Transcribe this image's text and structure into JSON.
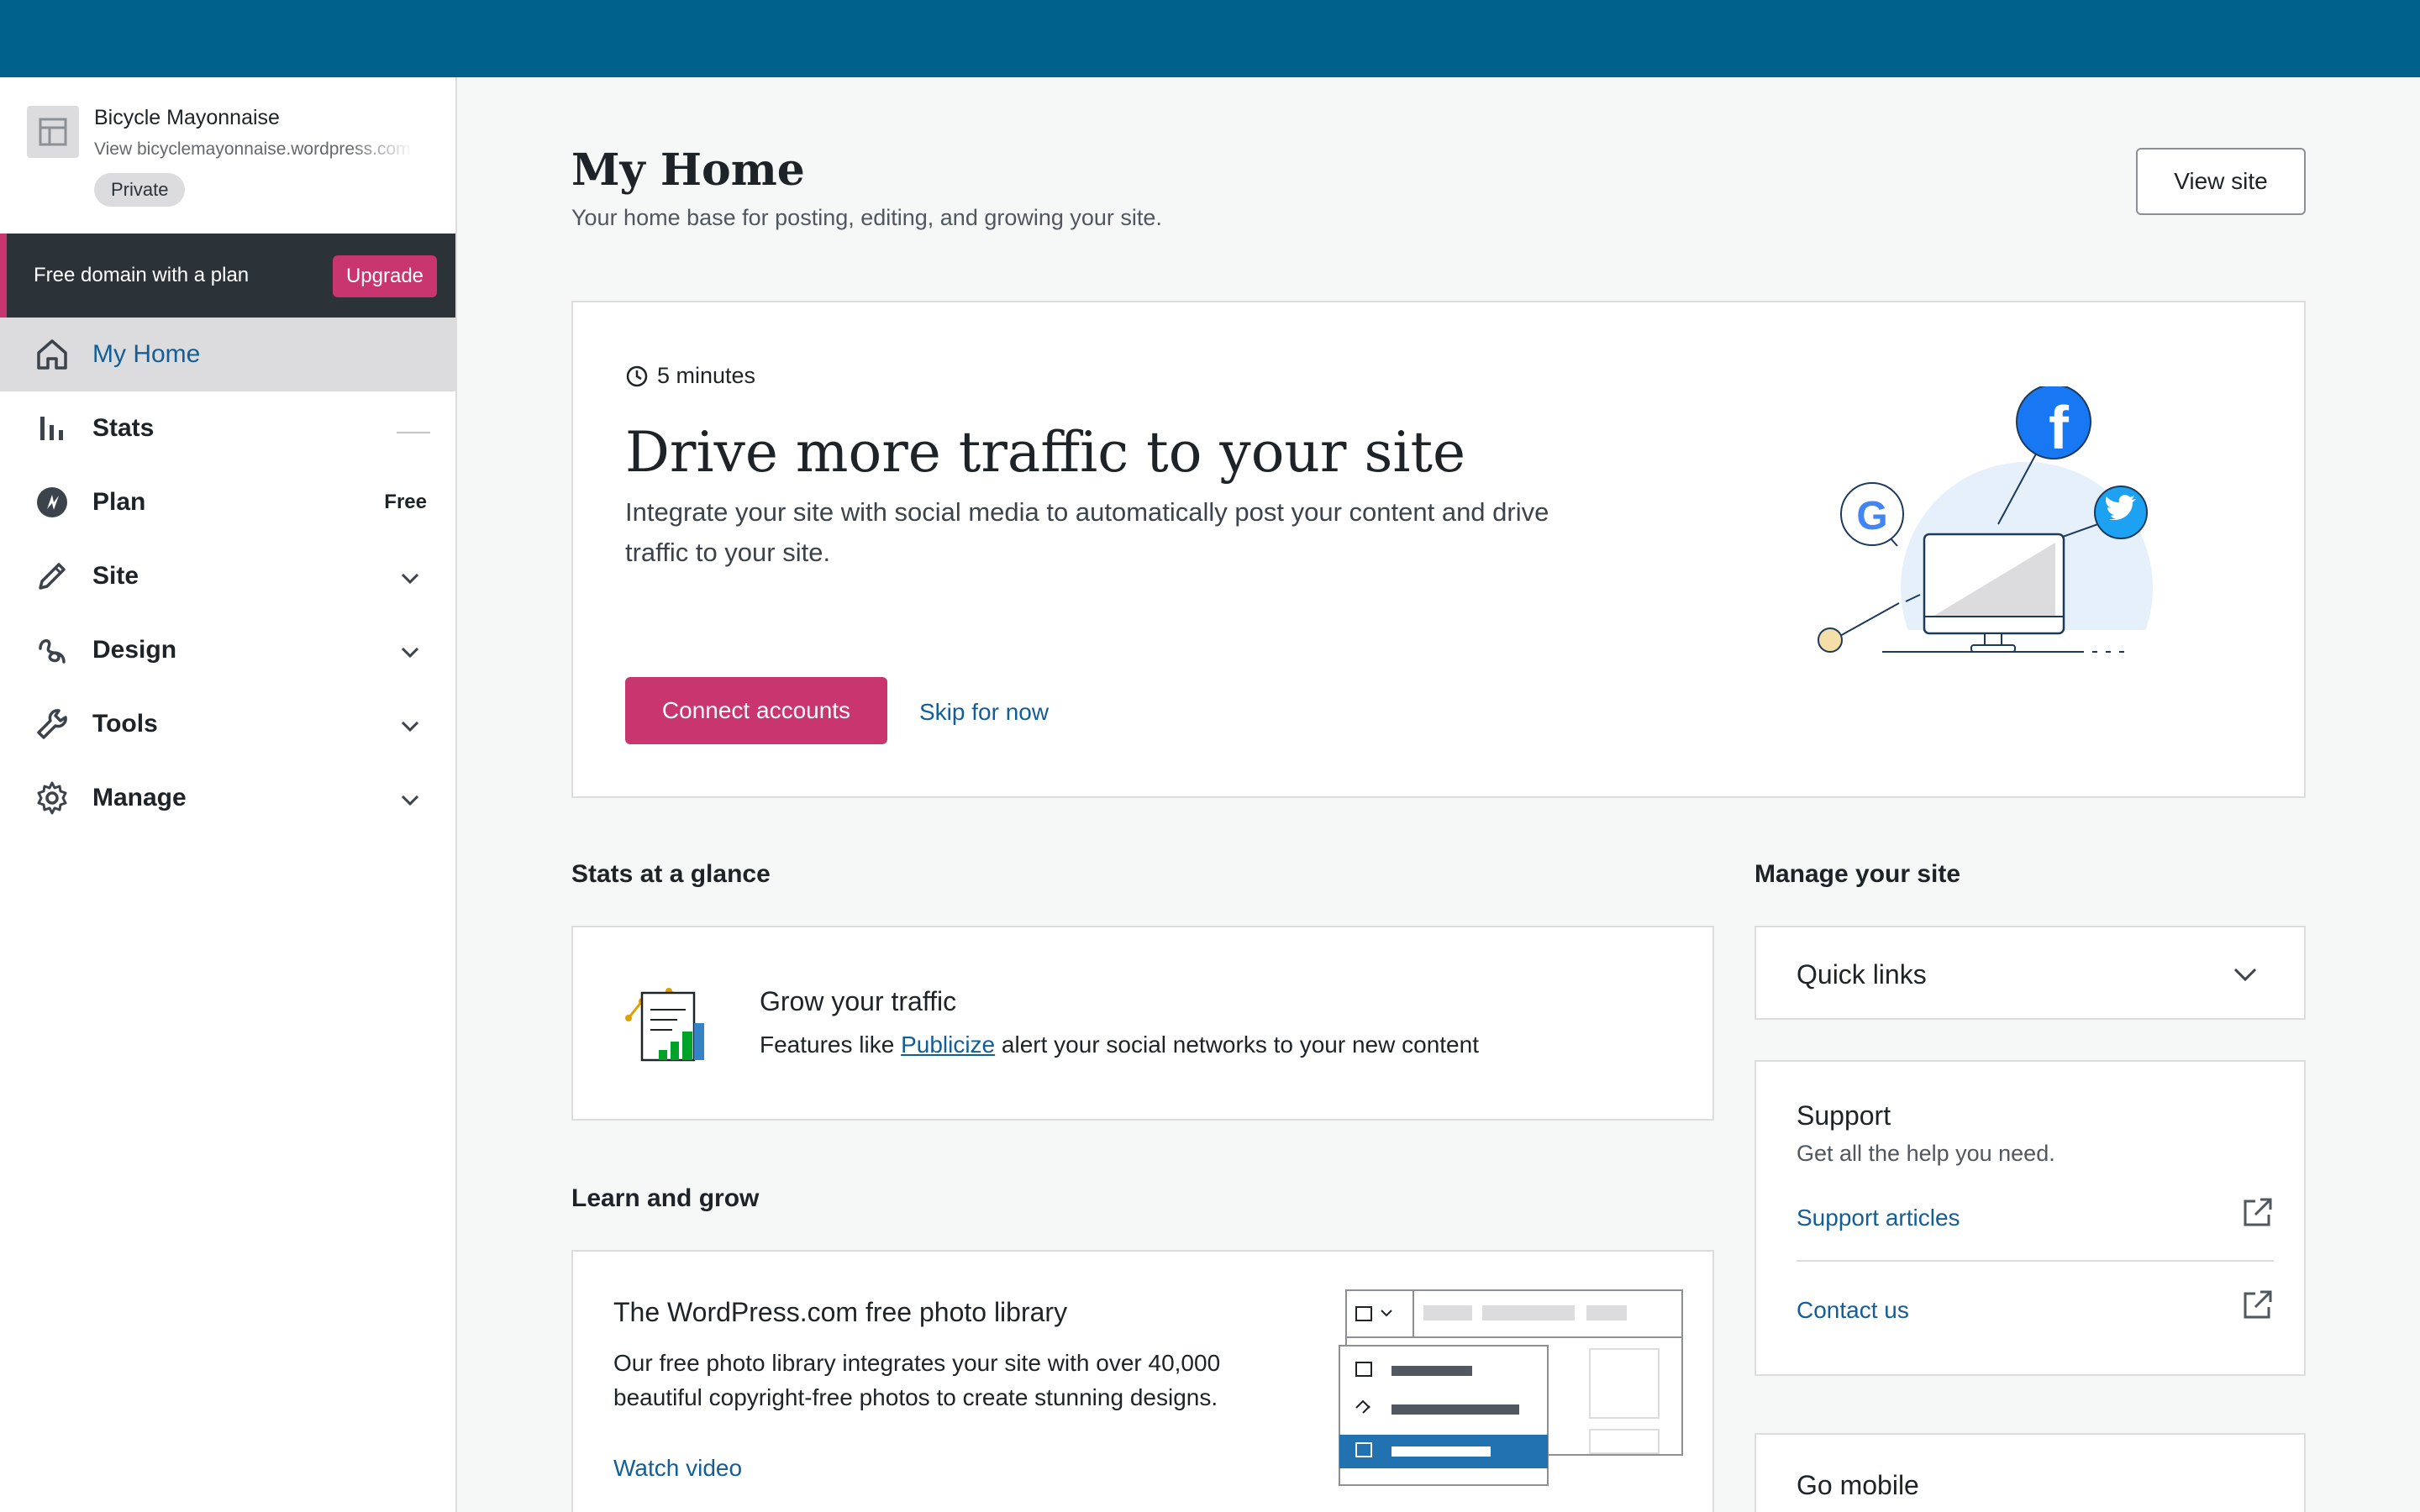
{
  "site": {
    "name": "Bicycle Mayonnaise",
    "url": "View bicyclemayonnaise.wordpress.com",
    "visibility": "Private"
  },
  "upsell": {
    "text": "Free domain with a plan",
    "button": "Upgrade"
  },
  "nav": {
    "items": [
      {
        "label": "My Home",
        "icon": "home-icon",
        "active": true
      },
      {
        "label": "Stats",
        "icon": "stats-icon"
      },
      {
        "label": "Plan",
        "icon": "plan-icon",
        "badge": "Free"
      },
      {
        "label": "Site",
        "icon": "pencil-icon"
      },
      {
        "label": "Design",
        "icon": "design-icon"
      },
      {
        "label": "Tools",
        "icon": "wrench-icon"
      },
      {
        "label": "Manage",
        "icon": "gear-icon"
      }
    ]
  },
  "header": {
    "title": "My Home",
    "subtitle": "Your home base for posting, editing, and growing your site.",
    "view_site": "View site"
  },
  "task": {
    "time": "5 minutes",
    "title": "Drive more traffic to your site",
    "description": "Integrate your site with social media to automatically post your content and drive traffic to your site.",
    "primary": "Connect accounts",
    "secondary": "Skip for now"
  },
  "stats": {
    "section_title": "Stats at a glance",
    "title": "Grow your traffic",
    "desc_before": "Features like ",
    "desc_link": "Publicize",
    "desc_after": " alert your social networks to your new content"
  },
  "learn": {
    "section_title": "Learn and grow",
    "title": "The WordPress.com free photo library",
    "description": "Our free photo library integrates your site with over 40,000 beautiful copyright-free photos to create stunning designs.",
    "link": "Watch video"
  },
  "manage": {
    "section_title": "Manage your site",
    "quick_links": "Quick links",
    "support_title": "Support",
    "support_sub": "Get all the help you need.",
    "support_links": [
      "Support articles",
      "Contact us"
    ],
    "go_mobile": "Go mobile"
  },
  "colors": {
    "masterbar": "#00628b",
    "accent_pink": "#c9356e",
    "link_blue": "#135e96",
    "upsell_bg": "#2c3338"
  }
}
